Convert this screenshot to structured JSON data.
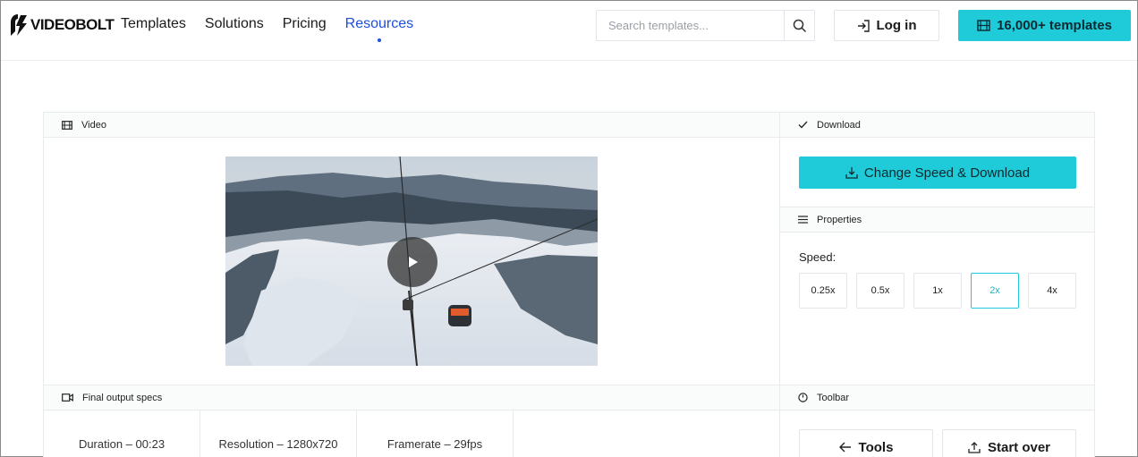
{
  "header": {
    "brand": "VIDEOBOLT",
    "nav": [
      {
        "label": "Templates"
      },
      {
        "label": "Solutions"
      },
      {
        "label": "Pricing"
      },
      {
        "label": "Resources",
        "active": true
      }
    ],
    "search_placeholder": "Search templates...",
    "login_label": "Log in",
    "templates_cta": "16,000+ templates"
  },
  "video": {
    "section_title": "Video",
    "icon": "film-icon",
    "play_icon": "play-icon"
  },
  "download": {
    "section_title": "Download",
    "cta_label": "Change Speed & Download"
  },
  "properties": {
    "section_title": "Properties",
    "speed_label": "Speed:",
    "speeds": [
      "0.25x",
      "0.5x",
      "1x",
      "2x",
      "4x"
    ],
    "selected_speed": "2x"
  },
  "specs": {
    "section_title": "Final output specs",
    "items": [
      "Duration – 00:23",
      "Resolution – 1280x720",
      "Framerate – 29fps"
    ]
  },
  "toolbar": {
    "section_title": "Toolbar",
    "tools_label": "Tools",
    "start_over_label": "Start over"
  },
  "colors": {
    "accent": "#1fcbd9",
    "nav_active": "#1d4fd8"
  }
}
